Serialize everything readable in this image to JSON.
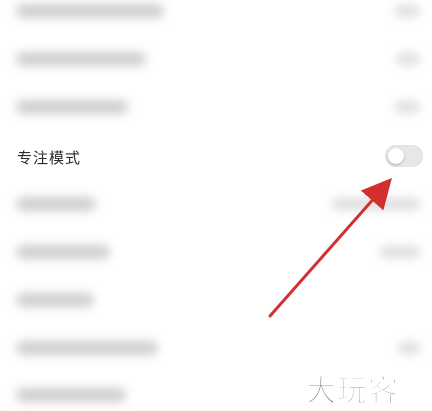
{
  "settings": {
    "focus_mode_label": "专注模式",
    "focus_mode_enabled": false
  },
  "annotation": {
    "arrow_color": "#d32f2f"
  },
  "watermark": {
    "text": "大玩客"
  }
}
